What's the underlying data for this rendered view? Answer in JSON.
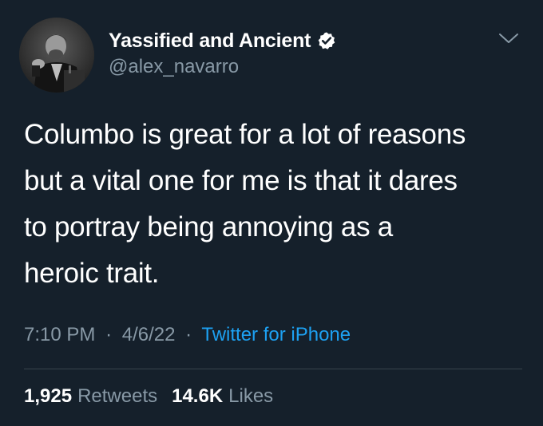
{
  "author": {
    "display_name": "Yassified and Ancient",
    "handle": "@alex_navarro",
    "verified": true,
    "avatar_icon": "profile-photo"
  },
  "tweet": {
    "text": "Columbo is great for a lot of reasons\nbut a vital one for me is that it dares\nto portray being annoying as a\nheroic trait."
  },
  "meta": {
    "time": "7:10 PM",
    "separator": "·",
    "date": "4/6/22",
    "source": "Twitter for iPhone"
  },
  "stats": {
    "retweets_count": "1,925",
    "retweets_label": "Retweets",
    "likes_count": "14.6K",
    "likes_label": "Likes"
  },
  "colors": {
    "background": "#15202b",
    "text_primary": "#ffffff",
    "text_secondary": "#8899a6",
    "link": "#1da1f2",
    "divider": "#38444d"
  },
  "icons": {
    "verified": "verified-badge-icon",
    "menu": "chevron-down-icon"
  }
}
